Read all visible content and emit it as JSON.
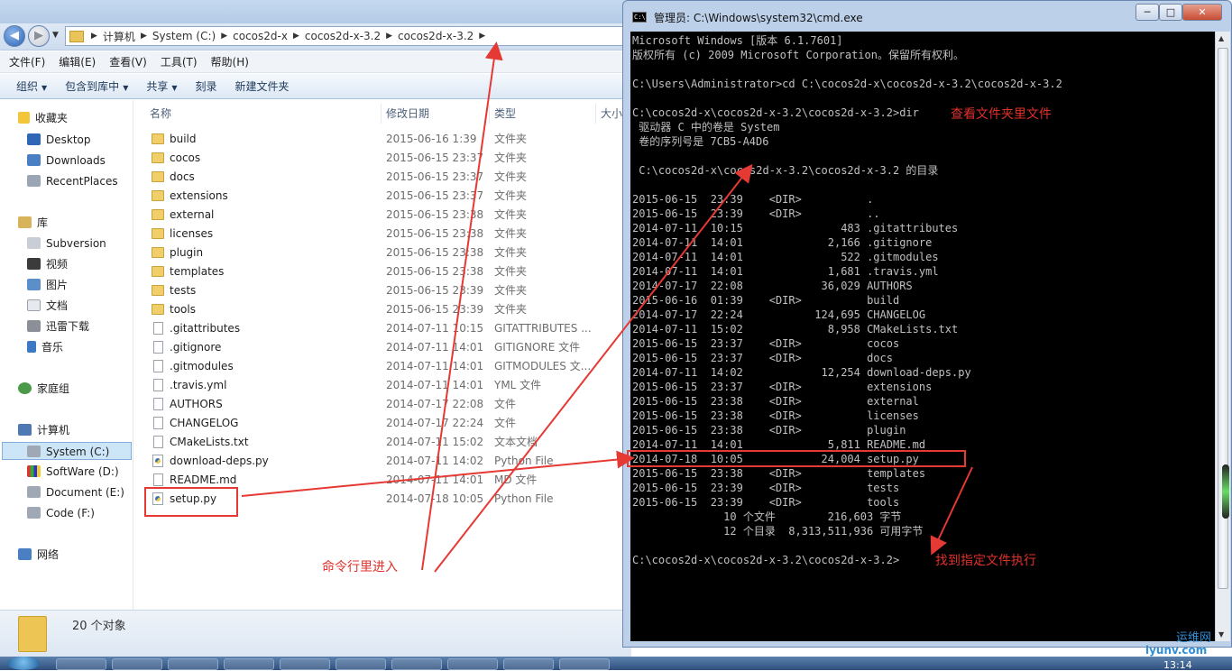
{
  "explorer": {
    "title": "",
    "address": {
      "breadcrumbs": [
        "计算机",
        "System (C:)",
        "cocos2d-x",
        "cocos2d-x-3.2",
        "cocos2d-x-3.2"
      ]
    },
    "menu": [
      "文件(F)",
      "编辑(E)",
      "查看(V)",
      "工具(T)",
      "帮助(H)"
    ],
    "toolbar": {
      "organize": "组织",
      "include_in_library": "包含到库中",
      "share": "共享",
      "burn": "刻录",
      "new_folder": "新建文件夹"
    },
    "nav": {
      "favorites": "收藏夹",
      "desktop": "Desktop",
      "downloads": "Downloads",
      "recent_places": "RecentPlaces",
      "libraries": "库",
      "subversion": "Subversion",
      "videos": "视频",
      "pictures": "图片",
      "documents": "文档",
      "xunlei": "迅雷下载",
      "music": "音乐",
      "homegroup": "家庭组",
      "computer": "计算机",
      "system_c": "System (C:)",
      "software_d": "SoftWare (D:)",
      "document_e": "Document (E:)",
      "code_f": "Code (F:)",
      "network": "网络"
    },
    "columns": {
      "name": "名称",
      "date": "修改日期",
      "type": "类型",
      "size": "大小"
    },
    "files": [
      {
        "name": "build",
        "date": "2015-06-16 1:39",
        "type": "文件夹",
        "icon": "folder"
      },
      {
        "name": "cocos",
        "date": "2015-06-15 23:37",
        "type": "文件夹",
        "icon": "folder"
      },
      {
        "name": "docs",
        "date": "2015-06-15 23:37",
        "type": "文件夹",
        "icon": "folder"
      },
      {
        "name": "extensions",
        "date": "2015-06-15 23:37",
        "type": "文件夹",
        "icon": "folder"
      },
      {
        "name": "external",
        "date": "2015-06-15 23:38",
        "type": "文件夹",
        "icon": "folder"
      },
      {
        "name": "licenses",
        "date": "2015-06-15 23:38",
        "type": "文件夹",
        "icon": "folder"
      },
      {
        "name": "plugin",
        "date": "2015-06-15 23:38",
        "type": "文件夹",
        "icon": "folder"
      },
      {
        "name": "templates",
        "date": "2015-06-15 23:38",
        "type": "文件夹",
        "icon": "folder"
      },
      {
        "name": "tests",
        "date": "2015-06-15 23:39",
        "type": "文件夹",
        "icon": "folder"
      },
      {
        "name": "tools",
        "date": "2015-06-15 23:39",
        "type": "文件夹",
        "icon": "folder"
      },
      {
        "name": ".gitattributes",
        "date": "2014-07-11 10:15",
        "type": "GITATTRIBUTES ...",
        "icon": "file"
      },
      {
        "name": ".gitignore",
        "date": "2014-07-11 14:01",
        "type": "GITIGNORE 文件",
        "icon": "file"
      },
      {
        "name": ".gitmodules",
        "date": "2014-07-11 14:01",
        "type": "GITMODULES 文...",
        "icon": "file"
      },
      {
        "name": ".travis.yml",
        "date": "2014-07-11 14:01",
        "type": "YML 文件",
        "icon": "file"
      },
      {
        "name": "AUTHORS",
        "date": "2014-07-17 22:08",
        "type": "文件",
        "icon": "file"
      },
      {
        "name": "CHANGELOG",
        "date": "2014-07-17 22:24",
        "type": "文件",
        "icon": "file"
      },
      {
        "name": "CMakeLists.txt",
        "date": "2014-07-11 15:02",
        "type": "文本文档",
        "icon": "file"
      },
      {
        "name": "download-deps.py",
        "date": "2014-07-11 14:02",
        "type": "Python File",
        "icon": "py"
      },
      {
        "name": "README.md",
        "date": "2014-07-11 14:01",
        "type": "MD 文件",
        "icon": "file"
      },
      {
        "name": "setup.py",
        "date": "2014-07-18 10:05",
        "type": "Python File",
        "icon": "py"
      }
    ],
    "status": "20 个对象"
  },
  "cmd": {
    "title": "管理员: C:\\Windows\\system32\\cmd.exe",
    "buttons": {
      "minimize": "─",
      "maximize": "□",
      "close": "✕"
    },
    "lines": [
      "Microsoft Windows [版本 6.1.7601]",
      "版权所有 (c) 2009 Microsoft Corporation。保留所有权利。",
      "",
      "C:\\Users\\Administrator>cd C:\\cocos2d-x\\cocos2d-x-3.2\\cocos2d-x-3.2",
      "",
      "C:\\cocos2d-x\\cocos2d-x-3.2\\cocos2d-x-3.2>dir",
      " 驱动器 C 中的卷是 System",
      " 卷的序列号是 7CB5-A4D6",
      "",
      " C:\\cocos2d-x\\cocos2d-x-3.2\\cocos2d-x-3.2 的目录",
      "",
      "2015-06-15  23:39    <DIR>          .",
      "2015-06-15  23:39    <DIR>          ..",
      "2014-07-11  10:15               483 .gitattributes",
      "2014-07-11  14:01             2,166 .gitignore",
      "2014-07-11  14:01               522 .gitmodules",
      "2014-07-11  14:01             1,681 .travis.yml",
      "2014-07-17  22:08            36,029 AUTHORS",
      "2015-06-16  01:39    <DIR>          build",
      "2014-07-17  22:24           124,695 CHANGELOG",
      "2014-07-11  15:02             8,958 CMakeLists.txt",
      "2015-06-15  23:37    <DIR>          cocos",
      "2015-06-15  23:37    <DIR>          docs",
      "2014-07-11  14:02            12,254 download-deps.py",
      "2015-06-15  23:37    <DIR>          extensions",
      "2015-06-15  23:38    <DIR>          external",
      "2015-06-15  23:38    <DIR>          licenses",
      "2015-06-15  23:38    <DIR>          plugin",
      "2014-07-11  14:01             5,811 README.md",
      "2014-07-18  10:05            24,004 setup.py",
      "2015-06-15  23:38    <DIR>          templates",
      "2015-06-15  23:39    <DIR>          tests",
      "2015-06-15  23:39    <DIR>          tools",
      "              10 个文件        216,603 字节",
      "              12 个目录  8,313,511,936 可用字节",
      "",
      "C:\\cocos2d-x\\cocos2d-x-3.2\\cocos2d-x-3.2>"
    ]
  },
  "annotations": {
    "view_files": "查看文件夹里文件",
    "enter_cmd": "命令行里进入",
    "find_run": "找到指定文件执行",
    "color": "#e1302a"
  },
  "taskbar": {
    "clock": "13:14"
  },
  "watermark": {
    "top": "运维网",
    "bottom": "iyunv.com"
  }
}
